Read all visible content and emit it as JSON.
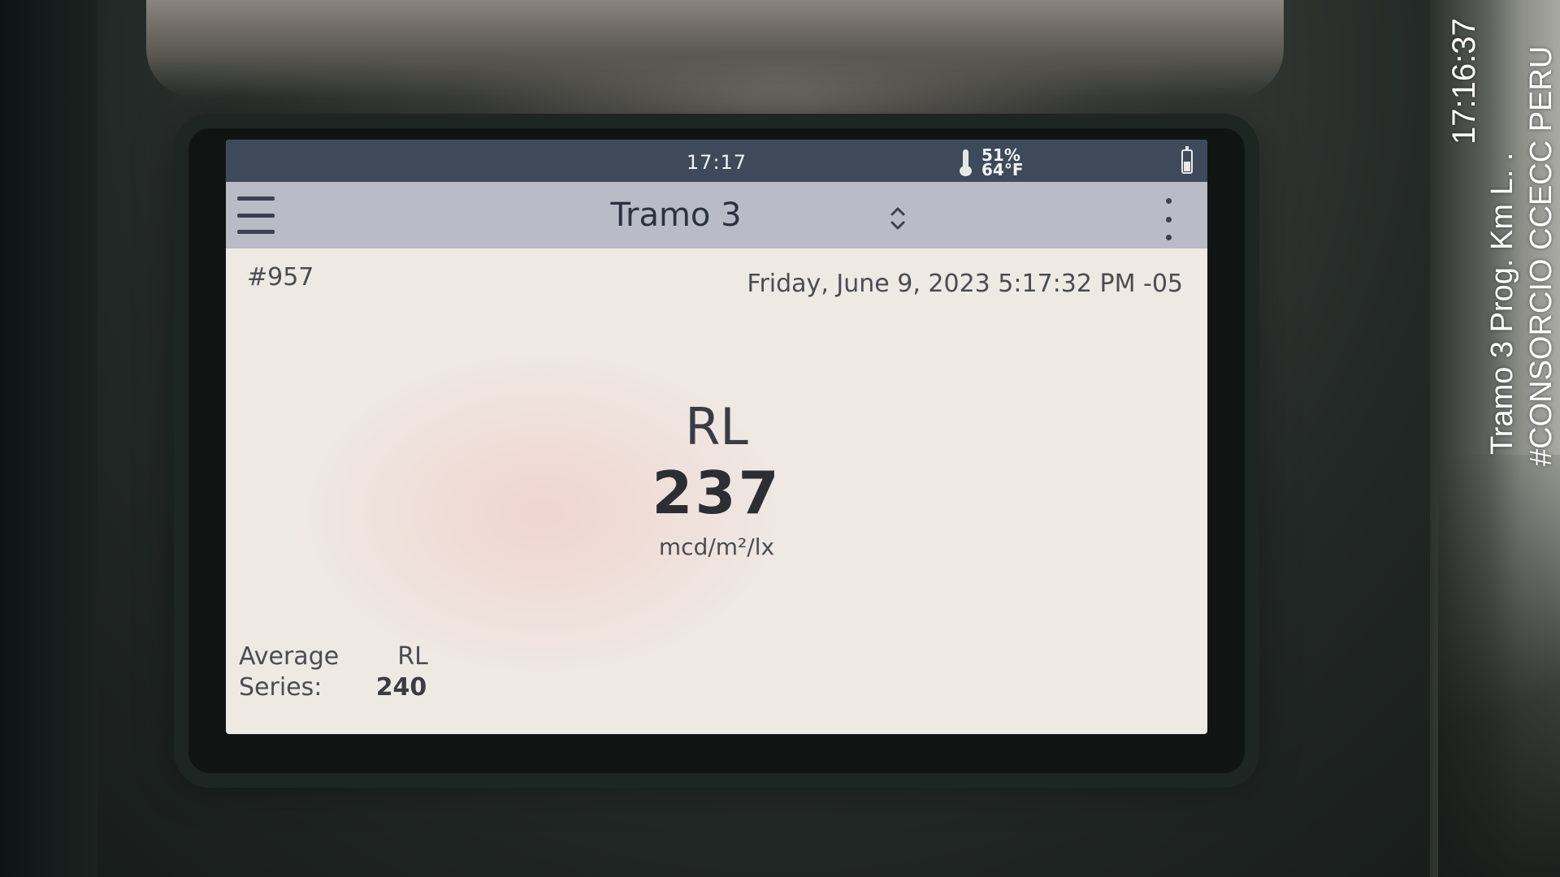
{
  "status_bar": {
    "time": "17:17",
    "humidity": "51%",
    "temperature": "64°F",
    "battery_level": 0.5
  },
  "app_bar": {
    "title": "Tramo 3"
  },
  "record": {
    "number": "#957",
    "datetime": "Friday, June 9, 2023 5:17:32 PM -05"
  },
  "reading": {
    "label": "RL",
    "value": "237",
    "unit": "mcd/m²/lx"
  },
  "average": {
    "label_line1": "Average",
    "column_header": "RL",
    "label_line2": "Series:",
    "value": "240"
  },
  "photo_watermark": {
    "time": "17:16:37",
    "location": "Tramo 3 Prog. Km    L. .",
    "organization": "#CONSORCIO CCECC PERU"
  },
  "colors": {
    "status_bar_bg": "#3e4a5a",
    "app_bar_bg": "#b9bcc6",
    "screen_bg": "#efe9e4",
    "text_primary": "#2c2e33"
  },
  "icons": {
    "menu": "hamburger-menu-icon",
    "thermometer": "thermometer-icon",
    "battery": "battery-icon",
    "sort": "up-down-chevron-icon",
    "overflow": "kebab-menu-icon"
  }
}
